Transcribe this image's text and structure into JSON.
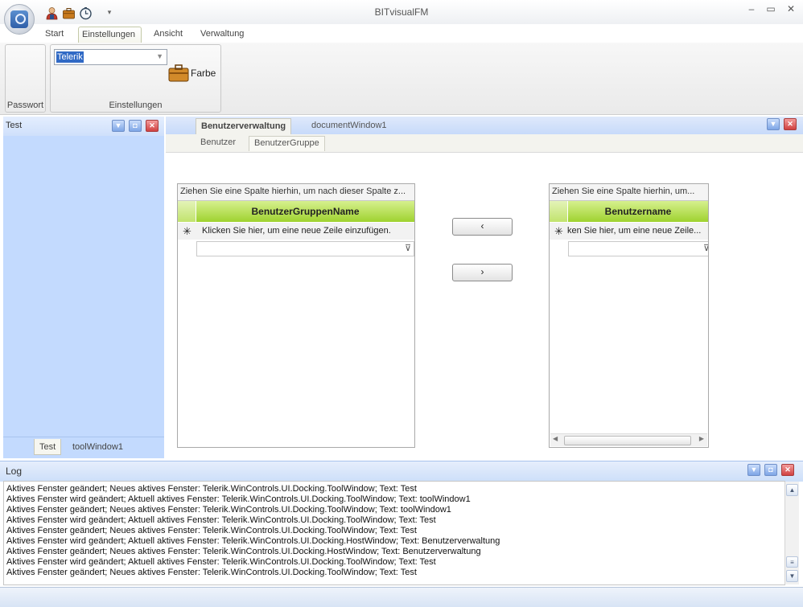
{
  "window": {
    "title": "BITvisualFM",
    "minimize": "–",
    "maximize": "▭",
    "close": "✕"
  },
  "menu": {
    "tabs": [
      "Start",
      "Einstellungen",
      "Ansicht",
      "Verwaltung"
    ],
    "active": "Einstellungen"
  },
  "ribbon": {
    "passwort_group": "Passwort",
    "einstellungen_group": "Einstellungen",
    "theme_combo_value": "Telerik",
    "farbe_label": "Farbe"
  },
  "tool_window": {
    "title": "Test",
    "tabs": [
      "Test",
      "toolWindow1"
    ],
    "active_tab": "Test"
  },
  "document": {
    "tabs": [
      "Benutzerverwaltung",
      "documentWindow1"
    ],
    "active_tab": "Benutzerverwaltung",
    "subtabs": [
      "Benutzer",
      "BenutzerGruppe"
    ],
    "active_subtab": "BenutzerGruppe"
  },
  "grid_left": {
    "group_hint": "Ziehen Sie eine Spalte hierhin, um nach dieser Spalte z...",
    "column": "BenutzerGruppenName",
    "new_row": "Klicken Sie hier, um eine neue Zeile einzufügen."
  },
  "grid_right": {
    "group_hint": "Ziehen Sie eine Spalte hierhin, um...",
    "column": "Benutzername",
    "new_row": "ken Sie hier, um eine neue Zeile..."
  },
  "buttons": {
    "move_left": "‹",
    "move_right": "›"
  },
  "log": {
    "title": "Log",
    "lines": [
      "Aktives Fenster geändert; Neues aktives Fenster: Telerik.WinControls.UI.Docking.ToolWindow; Text: Test",
      "Aktives Fenster wird geändert; Aktuell aktives Fenster: Telerik.WinControls.UI.Docking.ToolWindow; Text: toolWindow1",
      "Aktives Fenster geändert; Neues aktives Fenster: Telerik.WinControls.UI.Docking.ToolWindow; Text: toolWindow1",
      "Aktives Fenster wird geändert; Aktuell aktives Fenster: Telerik.WinControls.UI.Docking.ToolWindow; Text: Test",
      "Aktives Fenster geändert; Neues aktives Fenster: Telerik.WinControls.UI.Docking.ToolWindow; Text: Test",
      "Aktives Fenster wird geändert; Aktuell aktives Fenster: Telerik.WinControls.UI.Docking.HostWindow; Text: Benutzerverwaltung",
      "Aktives Fenster geändert; Neues aktives Fenster: Telerik.WinControls.UI.Docking.HostWindow; Text: Benutzerverwaltung",
      "Aktives Fenster wird geändert; Aktuell aktives Fenster: Telerik.WinControls.UI.Docking.ToolWindow; Text: Test",
      "Aktives Fenster geändert; Neues aktives Fenster: Telerik.WinControls.UI.Docking.ToolWindow; Text: Test"
    ]
  },
  "icons": {
    "user": "user-icon",
    "briefcase": "briefcase-icon",
    "clock": "clock-icon",
    "dropdown": "chevron-down-icon",
    "new_row": "asterisk-icon",
    "filter": "filter-icon"
  },
  "colors": {
    "accent": "#9fd22f",
    "dock_blue": "#c3dafe",
    "close_red": "#d04040"
  }
}
